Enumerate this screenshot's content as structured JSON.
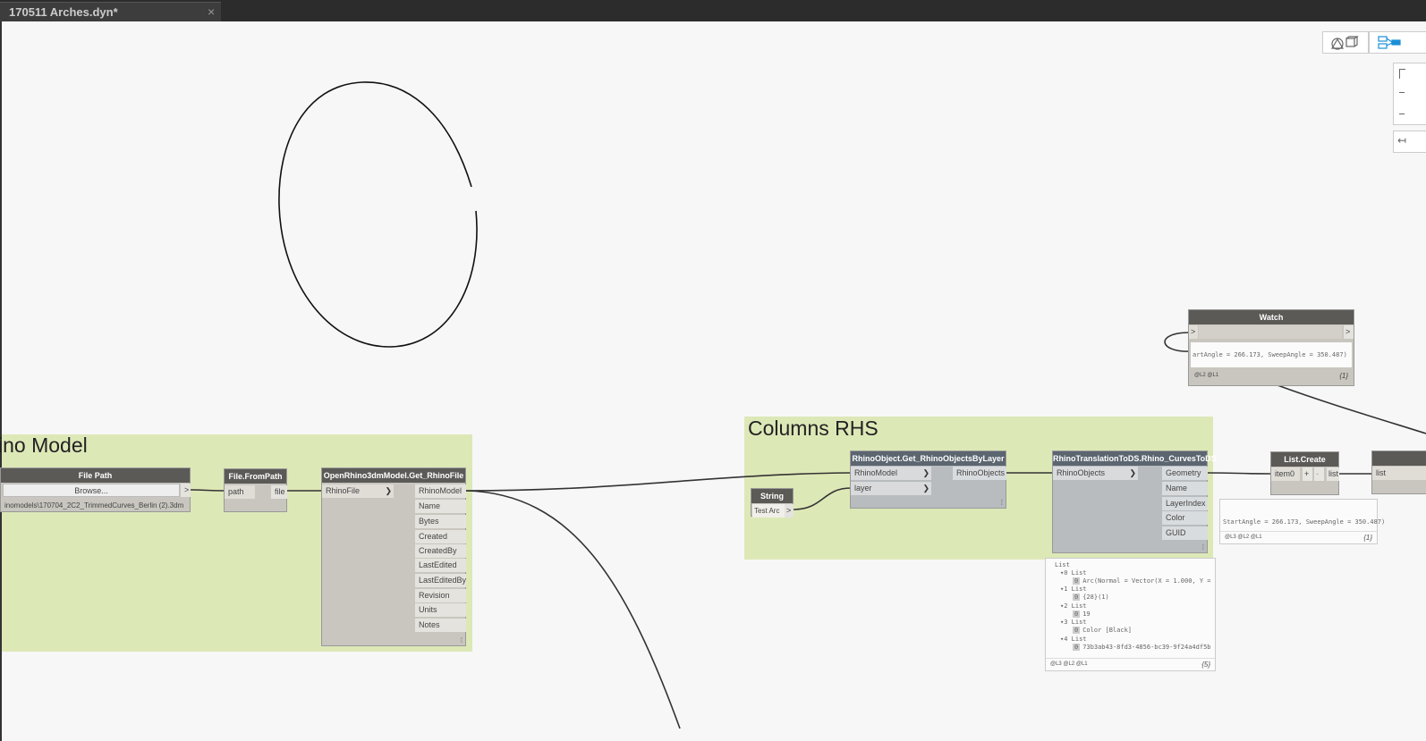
{
  "tab": {
    "title": "170511 Arches.dyn*",
    "close": "×"
  },
  "groups": {
    "rhino_model": {
      "title": "ino Model"
    },
    "columns_rhs": {
      "title": "Columns RHS"
    }
  },
  "nodes": {
    "file_path": {
      "title": "File Path",
      "button": "Browse...",
      "out": ">",
      "value": "inomodels\\170704_2C2_TrimmedCurves_Berlin (2).3dm"
    },
    "file_from_path": {
      "title": "File.FromPath",
      "in": "path",
      "out": "file"
    },
    "open_rhino": {
      "title": "OpenRhino3dmModel.Get_RhinoFile",
      "in": "RhinoFile",
      "outs": [
        "RhinoModel",
        "Name",
        "Bytes",
        "Created",
        "CreatedBy",
        "LastEdited",
        "LastEditedBy",
        "Revision",
        "Units",
        "Notes"
      ]
    },
    "get_objects": {
      "title": "RhinoObject.Get_RhinoObjectsByLayer",
      "ins": [
        "RhinoModel",
        "layer"
      ],
      "out": "RhinoObjects"
    },
    "string": {
      "title": "String",
      "value": "Test Arc",
      "out": ">"
    },
    "curves_to_ds": {
      "title": "RhinoTranslationToDS.Rhino_CurvesToDS",
      "in": "RhinoObjects",
      "outs": [
        "Geometry",
        "Name",
        "LayerIndex",
        "Color",
        "GUID"
      ]
    },
    "list_create": {
      "title": "List.Create",
      "in": "item0",
      "plus": "+",
      "minus": "-",
      "out": "list"
    },
    "partial_node": {
      "in": "list"
    },
    "watch": {
      "title": "Watch",
      "in": ">",
      "out": ">",
      "preview": "artAngle = 266.173, SweepAngle = 350.487)",
      "levels": "@L2 @L1",
      "count": "{1}"
    }
  },
  "previews": {
    "list_create": {
      "text": "StartAngle = 266.173, SweepAngle = 350.487)",
      "levels": "@L3 @L2 @L1",
      "count": "{1}"
    },
    "curves": {
      "lines": [
        {
          "text": "List",
          "idx": ""
        },
        {
          "text": "▾0 List",
          "idx": ""
        },
        {
          "text": "Arc(Normal = Vector(X = 1.000, Y =",
          "idx": "0"
        },
        {
          "text": "▾1 List",
          "idx": ""
        },
        {
          "text": "{28}(1)",
          "idx": "0"
        },
        {
          "text": "▾2 List",
          "idx": ""
        },
        {
          "text": "19",
          "idx": "0"
        },
        {
          "text": "▾3 List",
          "idx": ""
        },
        {
          "text": "Color [Black]",
          "idx": "0"
        },
        {
          "text": "▾4 List",
          "idx": ""
        },
        {
          "text": "73b3ab43-8fd3-4856-bc39-9f24a4df5b",
          "idx": "0"
        }
      ],
      "levels": "@L3 @L2 @L1",
      "count": "{5}"
    }
  }
}
